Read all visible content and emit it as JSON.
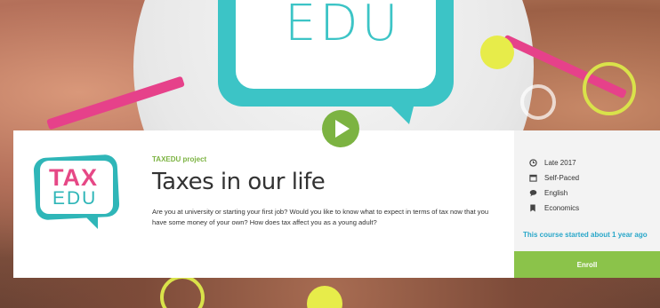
{
  "hero": {
    "watermark": "EDU"
  },
  "course": {
    "project": "TAXEDU project",
    "title": "Taxes in our life",
    "description": "Are you at university or starting your first job? Would you like to know what to expect in terms of tax now that you have some money of your own? How does tax affect you as a young adult?",
    "logo_top": "TAX",
    "logo_bottom": "EDU"
  },
  "meta": {
    "items": [
      {
        "icon": "clock-icon",
        "label": "Late 2017"
      },
      {
        "icon": "calendar-icon",
        "label": "Self-Paced"
      },
      {
        "icon": "speech-icon",
        "label": "English"
      },
      {
        "icon": "bookmark-icon",
        "label": "Economics"
      }
    ],
    "started": "This course started about 1 year ago",
    "enroll_label": "Enroll"
  },
  "colors": {
    "accent_green": "#8bc34a",
    "teal": "#2fb6b8",
    "pink": "#e64886",
    "link_blue": "#29a7c9"
  }
}
